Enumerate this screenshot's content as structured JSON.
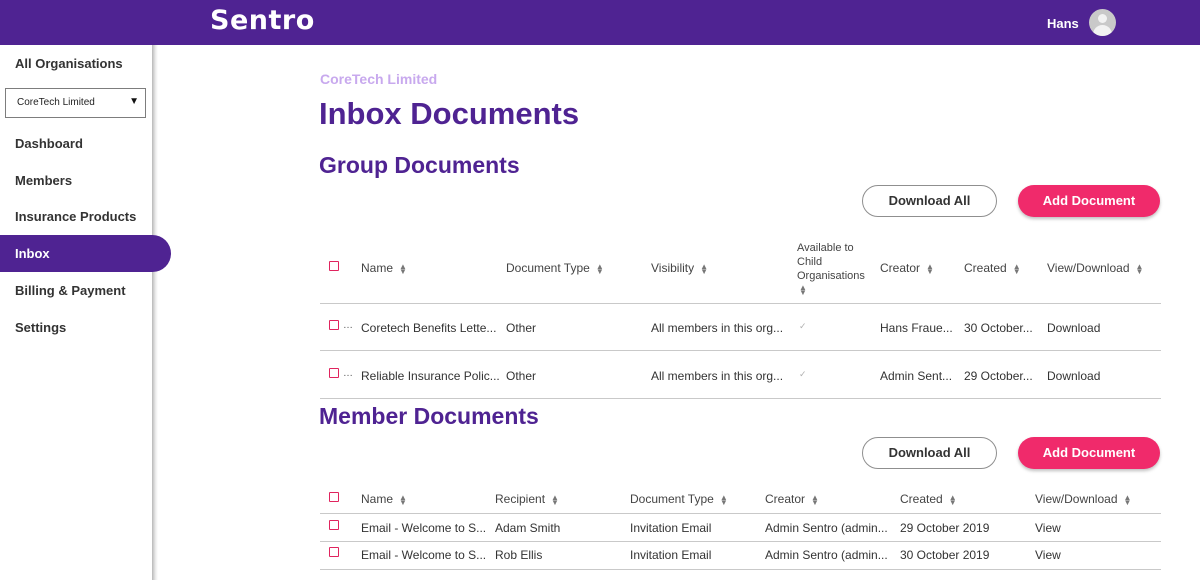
{
  "header": {
    "logo": "Sentro",
    "username": "Hans"
  },
  "sidebar": {
    "all_orgs": "All Organisations",
    "org_select_value": "CoreTech Limited",
    "items": [
      {
        "label": "Dashboard"
      },
      {
        "label": "Members"
      },
      {
        "label": "Insurance Products"
      },
      {
        "label": "Inbox"
      },
      {
        "label": "Billing & Payment"
      },
      {
        "label": "Settings"
      }
    ]
  },
  "main": {
    "org_name": "CoreTech Limited",
    "title": "Inbox Documents",
    "group": {
      "title": "Group Documents",
      "download_all": "Download All",
      "add_document": "Add Document",
      "columns": {
        "name": "Name",
        "doc_type": "Document Type",
        "visibility": "Visibility",
        "available_1": "Available to",
        "available_2": "Child",
        "available_3": "Organisations",
        "creator": "Creator",
        "created": "Created",
        "view": "View/Download"
      },
      "rows": [
        {
          "name": "Coretech Benefits Lette...",
          "doc_type": "Other",
          "visibility": "All members in this org...",
          "available": "✓",
          "creator": "Hans Fraue...",
          "created": "30 October...",
          "action": "Download"
        },
        {
          "name": "Reliable Insurance Polic...",
          "doc_type": "Other",
          "visibility": "All members in this org...",
          "available": "✓",
          "creator": "Admin Sent...",
          "created": "29 October...",
          "action": "Download"
        }
      ]
    },
    "member": {
      "title": "Member Documents",
      "download_all": "Download All",
      "add_document": "Add Document",
      "columns": {
        "name": "Name",
        "recipient": "Recipient",
        "doc_type": "Document Type",
        "creator": "Creator",
        "created": "Created",
        "view": "View/Download"
      },
      "rows": [
        {
          "name": "Email - Welcome to S...",
          "recipient": "Adam Smith",
          "doc_type": "Invitation Email",
          "creator": "Admin Sentro (admin...",
          "created": "29 October 2019",
          "action": "View"
        },
        {
          "name": "Email - Welcome to S...",
          "recipient": "Rob Ellis",
          "doc_type": "Invitation Email",
          "creator": "Admin Sentro (admin...",
          "created": "30 October 2019",
          "action": "View"
        }
      ]
    }
  },
  "colors": {
    "brand_purple": "#4f2392",
    "accent_pink": "#f02a6b",
    "org_name_lilac": "#c8a9ee"
  }
}
